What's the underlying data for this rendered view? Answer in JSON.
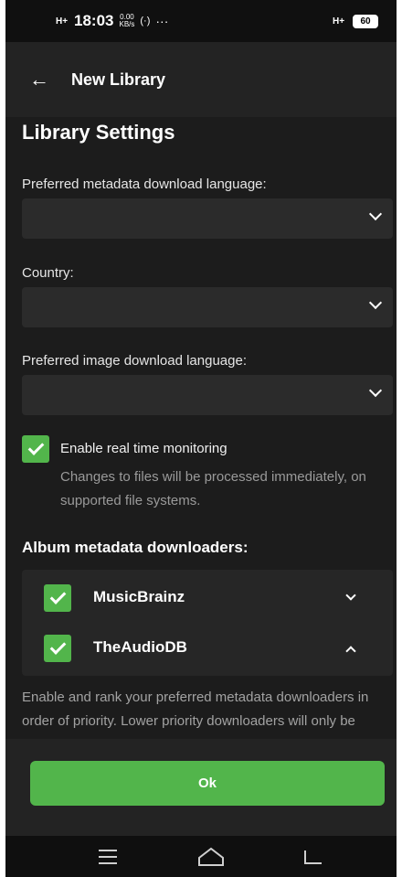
{
  "status_bar": {
    "signal": "H+",
    "time": "18:03",
    "net_speed_value": "0.00",
    "net_speed_unit": "KB/s",
    "more": "···",
    "right_signal": "H+",
    "battery": "60"
  },
  "app_bar": {
    "title": "New Library",
    "back_icon": "arrow-left-icon"
  },
  "content": {
    "section_title": "Library Settings",
    "metadata_language_label": "Preferred metadata download language:",
    "metadata_language_value": "",
    "country_label": "Country:",
    "country_value": "",
    "image_language_label": "Preferred image download language:",
    "image_language_value": "",
    "realtime_monitoring": {
      "label": "Enable real time monitoring",
      "checked": true,
      "description": "Changes to files will be processed immediately, on supported file systems."
    },
    "album_downloaders_heading": "Album metadata downloaders:",
    "downloaders": [
      {
        "name": "MusicBrainz",
        "checked": true,
        "chevron": "chevron-down-icon"
      },
      {
        "name": "TheAudioDB",
        "checked": true,
        "chevron": "chevron-up-icon"
      }
    ],
    "downloaders_help": "Enable and rank your preferred metadata downloaders in order of priority. Lower priority downloaders will only be"
  },
  "footer": {
    "ok_label": "Ok"
  },
  "colors": {
    "accent": "#52b54b",
    "background": "#1c1c1c"
  }
}
